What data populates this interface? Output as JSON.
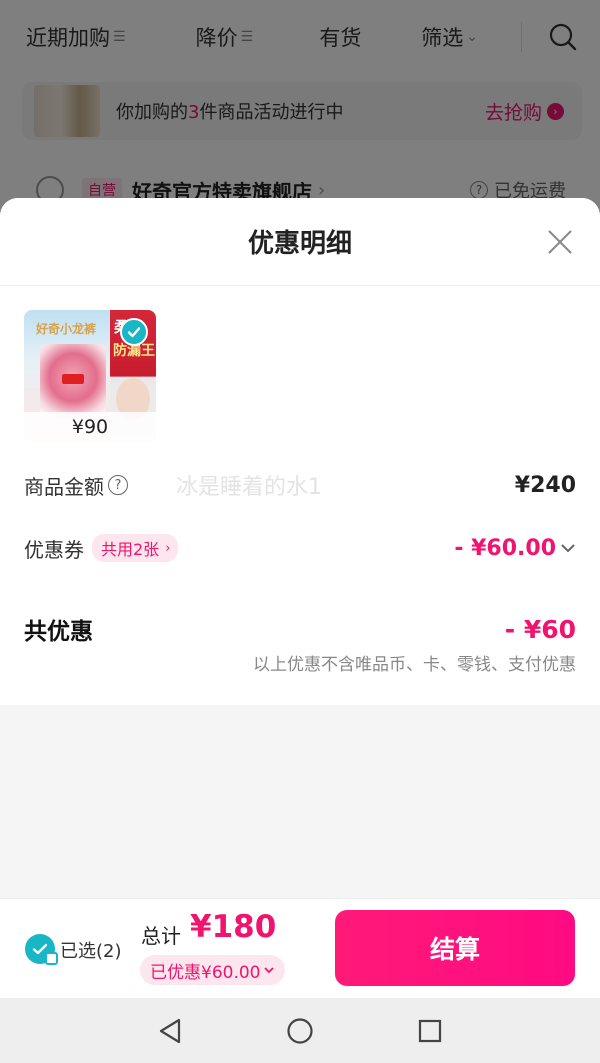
{
  "topbar": {
    "filters": [
      {
        "label": "近期加购",
        "suffix": "☰"
      },
      {
        "label": "降价",
        "suffix": "☰"
      },
      {
        "label": "有货",
        "suffix": ""
      },
      {
        "label": "筛选",
        "suffix": "⌄"
      }
    ]
  },
  "promo": {
    "text_prefix": "你加购的",
    "count": "3",
    "text_suffix": "件商品活动进行中",
    "action": "去抢购"
  },
  "store": {
    "tag": "自营",
    "name": "好奇官方特卖旗舰店",
    "shipping": "已免运费"
  },
  "sheet": {
    "title": "优惠明细",
    "product": {
      "brand_text": "好奇小龙裤",
      "badge_line1": "柔级",
      "badge_line2": "防漏王",
      "price": "¥90"
    },
    "amount_label": "商品金额",
    "watermark": "冰是睡着的水1",
    "amount_value": "¥240",
    "coupon_label": "优惠券",
    "coupon_tag": "共用2张",
    "coupon_value": "- ¥60.00",
    "total_label": "共优惠",
    "total_value": "- ¥60",
    "note": "以上优惠不含唯品币、卡、零钱、支付优惠"
  },
  "checkout": {
    "selected": "已选(2)",
    "sum_label": "总计",
    "sum_value": "¥180",
    "discount": "已优惠¥60.00",
    "pay_label": "结算"
  },
  "colors": {
    "accent": "#f0146e",
    "check": "#19b6c6"
  }
}
